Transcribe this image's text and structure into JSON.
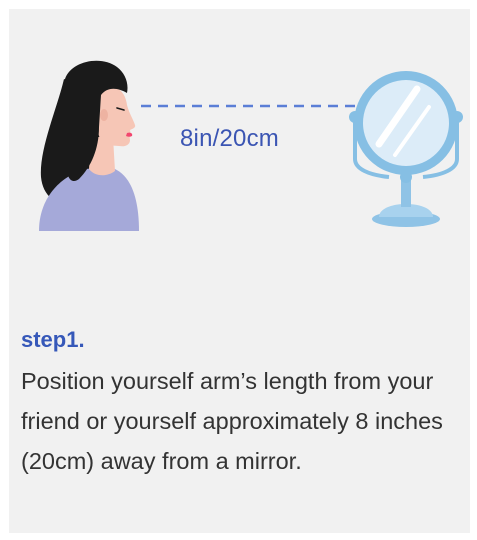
{
  "illustration": {
    "distance_label": "8in/20cm",
    "colors": {
      "dash_line": "#5b7ed6",
      "hair": "#1a1a1a",
      "skin": "#f6c6b6",
      "lips": "#f2476f",
      "shirt": "#a5a9d9",
      "mirror_frame": "#86bfe4",
      "mirror_glass": "#dcecf8",
      "mirror_stand": "#8fc3e6"
    }
  },
  "step": {
    "title": "step1.",
    "description": "Position yourself arm’s length from your friend or yourself approximately 8 inches (20cm) away from a mirror."
  }
}
